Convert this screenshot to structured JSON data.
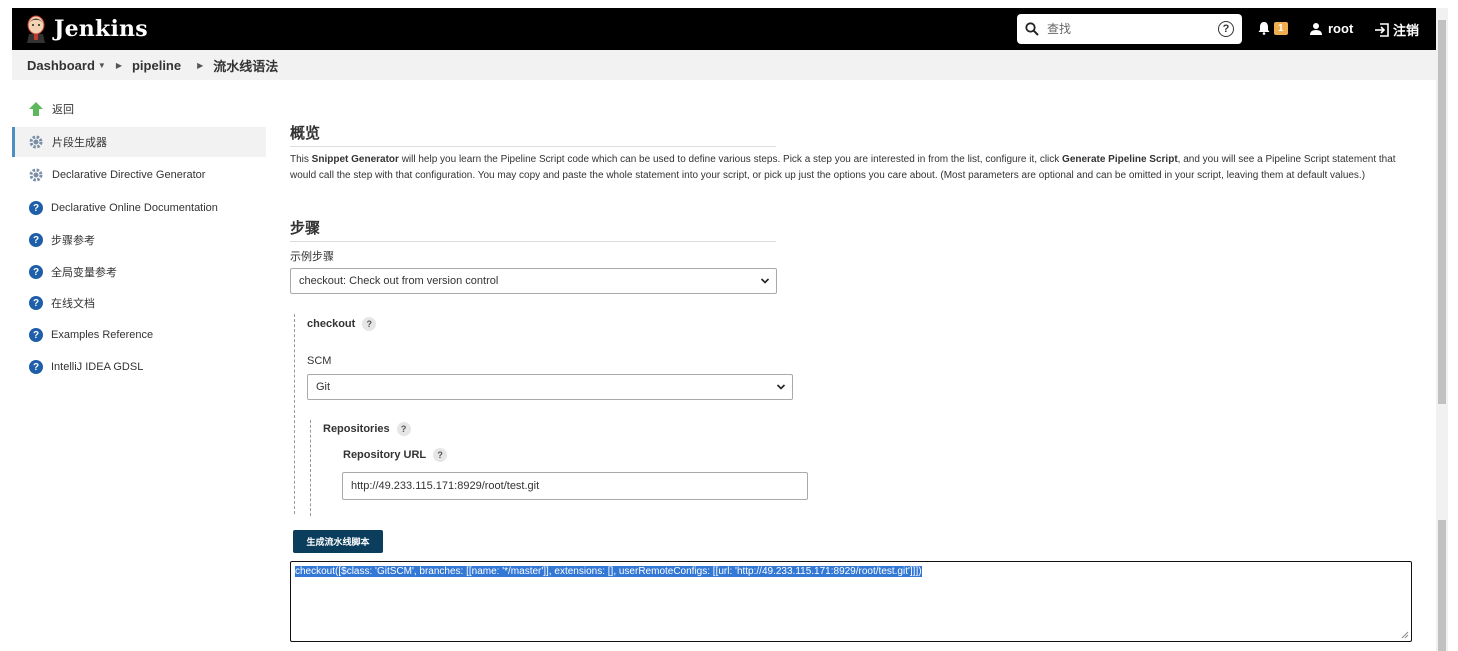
{
  "header": {
    "brand": "Jenkins",
    "search_placeholder": "查找",
    "notification_count": "1",
    "user": "root",
    "logout": "注销"
  },
  "breadcrumb": [
    "Dashboard",
    "pipeline",
    "流水线语法"
  ],
  "sidebar": {
    "items": [
      {
        "label": "返回",
        "icon": "up-arrow-icon"
      },
      {
        "label": "片段生成器",
        "icon": "gear-icon"
      },
      {
        "label": "Declarative Directive Generator",
        "icon": "gear-icon"
      },
      {
        "label": "Declarative Online Documentation",
        "icon": "help-icon"
      },
      {
        "label": "步骤参考",
        "icon": "help-icon"
      },
      {
        "label": "全局变量参考",
        "icon": "help-icon"
      },
      {
        "label": "在线文档",
        "icon": "help-icon"
      },
      {
        "label": "Examples Reference",
        "icon": "help-icon"
      },
      {
        "label": "IntelliJ IDEA GDSL",
        "icon": "help-icon"
      }
    ]
  },
  "main": {
    "overview_title": "概览",
    "desc_1": "This ",
    "desc_snippet": "Snippet Generator",
    "desc_2": " will help you learn the Pipeline Script code which can be used to define various steps. Pick a step you are interested in from the list, configure it, click ",
    "desc_generate": "Generate Pipeline Script",
    "desc_3": ", and you will see a Pipeline Script statement that would call the step with that configuration. You may copy and paste the whole statement into your script, or pick up just the options you care about. (Most parameters are optional and can be omitted in your script, leaving them at default values.)",
    "steps_title": "步骤",
    "sample_step_label": "示例步骤",
    "sample_step_value": "checkout: Check out from version control",
    "checkout_label": "checkout",
    "scm_label": "SCM",
    "scm_value": "Git",
    "repositories_label": "Repositories",
    "repo_url_label": "Repository URL",
    "repo_url_value": "http://49.233.115.171:8929/root/test.git",
    "generate_button": "生成流水线脚本",
    "output": "checkout([$class: 'GitSCM', branches: [[name: '*/master']], extensions: [], userRemoteConfigs: [[url: 'http://49.233.115.171:8929/root/test.git']]])"
  },
  "colors": {
    "topbar": "#000000",
    "accent": "#4a90c2",
    "button": "#0b3d5c",
    "badge": "#f0ad4e",
    "selection": "#3478d6"
  }
}
